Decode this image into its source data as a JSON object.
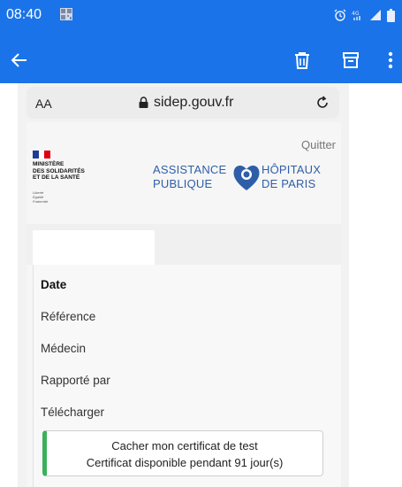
{
  "status_bar": {
    "time": "08:40",
    "icons": [
      "qr-code-icon",
      "alarm-icon",
      "data-4g-icon",
      "signal-icon",
      "battery-icon"
    ]
  },
  "app_bar": {
    "icons": [
      "back-arrow-icon",
      "trash-icon",
      "archive-icon",
      "more-vert-icon"
    ],
    "background": "#1a73e8"
  },
  "browser": {
    "text_size_label": "AA",
    "url": "sidep.gouv.fr"
  },
  "page": {
    "quit_label": "Quitter",
    "ministry_name": "MINISTÈRE\nDES SOLIDARITÉS\nET DE LA SANTÉ",
    "motto": "Liberté\nÉgalité\nFraternité",
    "aphp_left": "ASSISTANCE\nPUBLIQUE",
    "aphp_right": "HÔPITAUX\nDE PARIS",
    "rows": [
      {
        "label": "Date"
      },
      {
        "label": "Référence"
      },
      {
        "label": "Médecin"
      },
      {
        "label": "Rapporté par"
      },
      {
        "label": "Télécharger"
      }
    ],
    "certificate": {
      "line1": "Cacher mon certificat de test",
      "line2": "Certificat disponible pendant 91 jour(s)",
      "accent": "#3ab15a"
    }
  }
}
